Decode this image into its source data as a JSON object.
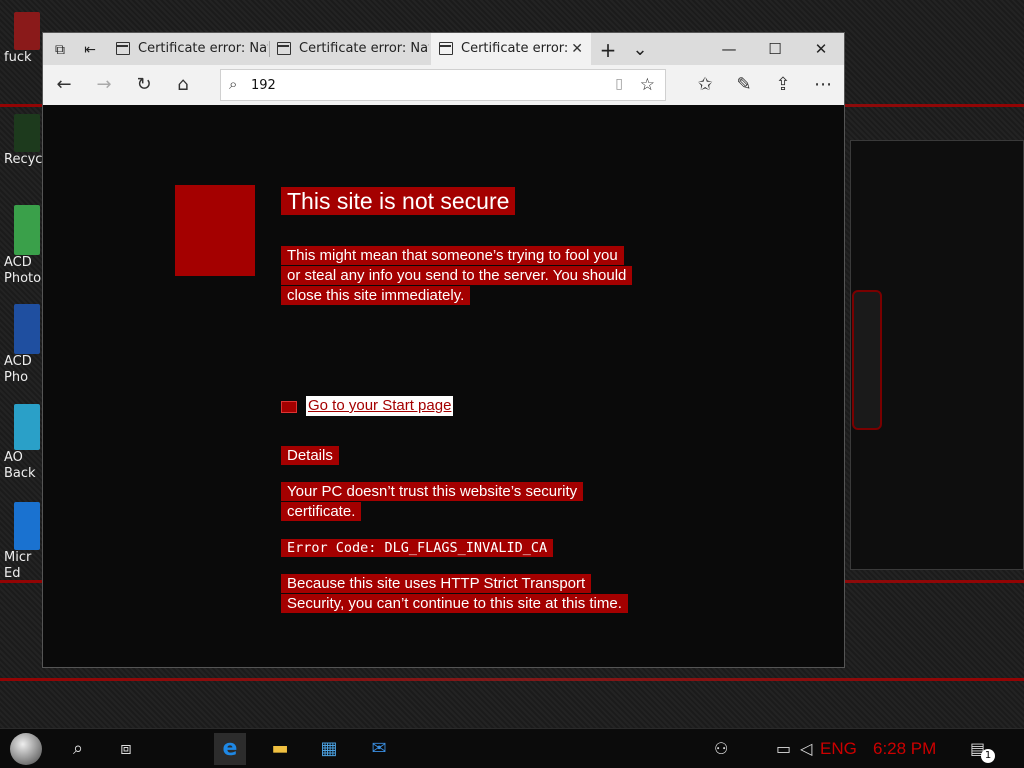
{
  "desktop": {
    "icons": [
      {
        "label_line1": "fuck",
        "label_line2": ""
      },
      {
        "label_line1": "Recyc",
        "label_line2": ""
      },
      {
        "label_line1": "ACD",
        "label_line2": "Photo"
      },
      {
        "label_line1": "ACD",
        "label_line2": "Pho"
      },
      {
        "label_line1": "AO",
        "label_line2": "Back"
      },
      {
        "label_line1": "Micr",
        "label_line2": "Ed"
      }
    ]
  },
  "browser": {
    "tabs": [
      {
        "title": "Certificate error: Nav"
      },
      {
        "title": "Certificate error: Nav"
      },
      {
        "title": "Certificate error:"
      }
    ],
    "address": {
      "value": "192"
    },
    "icons": {
      "tab-preview": "⧉",
      "set-aside": "⇤",
      "new-tab": "+",
      "tab-list": "⌄",
      "minimize": "—",
      "maximize": "☐",
      "close": "✕",
      "back": "←",
      "forward": "→",
      "refresh": "↻",
      "home": "⌂",
      "search": "⌕",
      "reading-view": "▯",
      "favorite": "☆",
      "favorites-hub": "✩",
      "notes": "✎",
      "share": "⇪",
      "more": "⋯"
    }
  },
  "page": {
    "title": "This site is not secure",
    "message": "This might mean that someone’s trying to fool you or steal any info you send to the server. You should close this site immediately.",
    "go_start": "Go to your Start page",
    "details": "Details",
    "pc_trust": "Your PC doesn’t trust this website’s security certificate.",
    "error_code": "Error Code: DLG_FLAGS_INVALID_CA",
    "hsts": "Because this site uses HTTP Strict Transport Security, you can’t continue to this site at this time."
  },
  "taskbar": {
    "language": "ENG",
    "time": "6:28 PM",
    "notification_count": "1"
  },
  "colors": {
    "error_red": "#a40000",
    "clock_red": "#cc0000"
  }
}
